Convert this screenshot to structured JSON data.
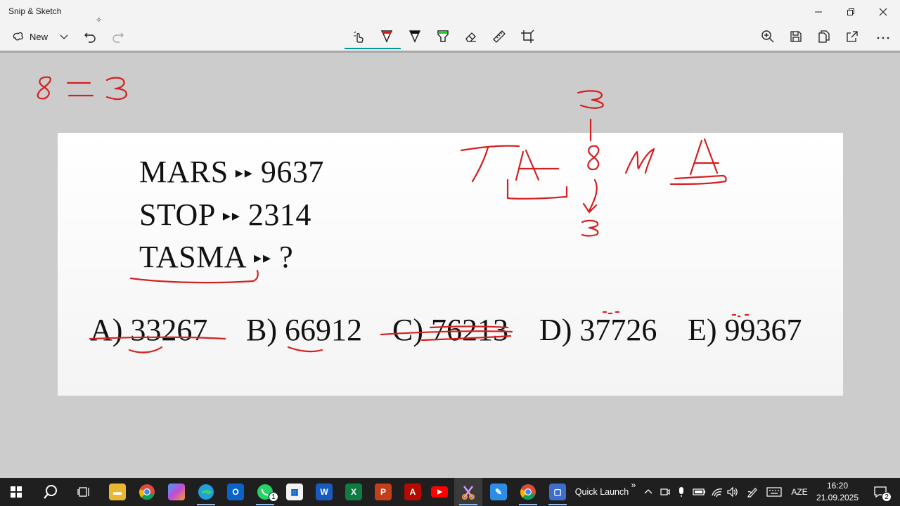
{
  "window": {
    "title": "Snip & Sketch"
  },
  "toolbar": {
    "new_label": "New",
    "tools": [
      "touch-writing",
      "ballpoint-pen",
      "pencil",
      "highlighter",
      "eraser",
      "ruler",
      "crop"
    ],
    "actions": [
      "zoom",
      "save",
      "copy",
      "share",
      "more"
    ]
  },
  "puzzle": {
    "lines": [
      {
        "word": "MARS",
        "arrows": "▸▸",
        "code": "9637"
      },
      {
        "word": "STOP",
        "arrows": "▸▸",
        "code": "2314"
      },
      {
        "word": "TASMA",
        "arrows": "▸▸",
        "code": "?"
      }
    ],
    "answers": [
      "A) 33267",
      "B) 66912",
      "C) 76213",
      "D) 37726",
      "E) 99367"
    ]
  },
  "annotations": {
    "equation": "8 = 3",
    "letters_left": "T A",
    "middle": "8",
    "letters_right": "M A",
    "top_digit": "3",
    "bottom_digit": "3",
    "ink_color": "#d42020"
  },
  "taskbar": {
    "quick_launch_label": "Quick Launch",
    "chevron": "»",
    "language": "AZE",
    "time": "16:20",
    "date": "21.09.2025",
    "whatsapp_badge": "1",
    "notification_badge": "2"
  },
  "colors": {
    "accent": "#009999",
    "taskbar": "#1f1f1f",
    "canvas": "#cccccc"
  }
}
